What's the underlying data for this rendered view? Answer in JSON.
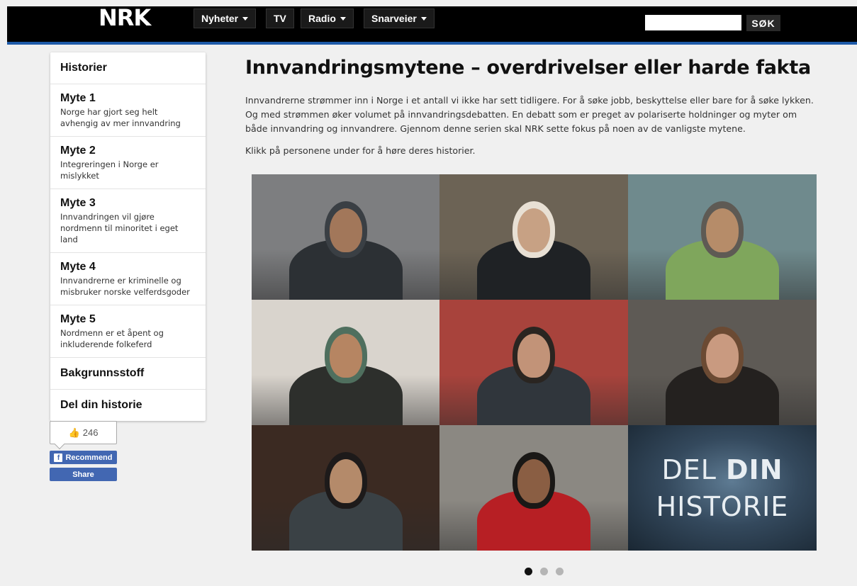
{
  "header": {
    "logo": "NRK",
    "nav": [
      {
        "label": "Nyheter",
        "dropdown": true
      },
      {
        "label": "TV",
        "dropdown": false
      },
      {
        "label": "Radio",
        "dropdown": true
      },
      {
        "label": "Snarveier",
        "dropdown": true
      }
    ],
    "search_placeholder": "",
    "search_button": "SØK"
  },
  "sidebar": {
    "items": [
      {
        "title": "Historier",
        "subtitle": ""
      },
      {
        "title": "Myte 1",
        "subtitle": "Norge har gjort seg helt avhengig av mer innvandring"
      },
      {
        "title": "Myte 2",
        "subtitle": "Integreringen i Norge er mislykket"
      },
      {
        "title": "Myte 3",
        "subtitle": "Innvandringen vil gjøre nordmenn til minoritet i eget land"
      },
      {
        "title": "Myte 4",
        "subtitle": "Innvandrerne er kriminelle og misbruker norske velferdsgoder"
      },
      {
        "title": "Myte 5",
        "subtitle": "Nordmenn er et åpent og inkluderende folkeferd"
      },
      {
        "title": "Bakgrunnsstoff",
        "subtitle": ""
      },
      {
        "title": "Del din historie",
        "subtitle": ""
      }
    ]
  },
  "social": {
    "like_count": "246",
    "recommend_label": "Recommend",
    "share_label": "Share",
    "fb_icon": "f"
  },
  "main": {
    "title": "Innvandringsmytene – overdrivelser eller harde fakta",
    "intro": "Innvandrerne strømmer inn i Norge i et antall vi ikke har sett tidligere. For å søke jobb, beskyttelse eller bare for å søke lykken. Og med strømmen øker volumet på innvandringsdebatten. En debatt som er preget av polariserte holdninger og myter om både innvandring og innvandrere. Gjennom denne serien skal NRK sette fokus på noen av de vanligste mytene.",
    "instruction": "Klikk på personene under for å høre deres historier.",
    "tiles": [
      {
        "kind": "photo",
        "bg": "#7d7e80",
        "skin": "#a2775a",
        "cloth": "#2c3034",
        "hair": "#3a3f44"
      },
      {
        "kind": "photo",
        "bg": "#6c6355",
        "skin": "#c7a184",
        "cloth": "#1f2225",
        "hair": "#e8e0d4"
      },
      {
        "kind": "photo",
        "bg": "#6f8a8d",
        "skin": "#b68c69",
        "cloth": "#7fa65c",
        "hair": "#5e5a54"
      },
      {
        "kind": "photo",
        "bg": "#d9d4cd",
        "skin": "#b68562",
        "cloth": "#2d2f2c",
        "hair": "#4f6f5e"
      },
      {
        "kind": "photo",
        "bg": "#a8433c",
        "skin": "#c29378",
        "cloth": "#30363c",
        "hair": "#2a2521"
      },
      {
        "kind": "photo",
        "bg": "#5e5a55",
        "skin": "#c99a80",
        "cloth": "#24211f",
        "hair": "#6b4a33"
      },
      {
        "kind": "photo",
        "bg": "#3b2a22",
        "skin": "#b48a6a",
        "cloth": "#3a4145",
        "hair": "#1d1a1a"
      },
      {
        "kind": "photo",
        "bg": "#8b8882",
        "skin": "#8a5e43",
        "cloth": "#b71f24",
        "hair": "#1a1816"
      },
      {
        "kind": "cta",
        "line1_a": "DEL ",
        "line1_b": "DIN",
        "line2": "HISTORIE"
      }
    ],
    "pager": {
      "count": 3,
      "active": 0
    }
  }
}
